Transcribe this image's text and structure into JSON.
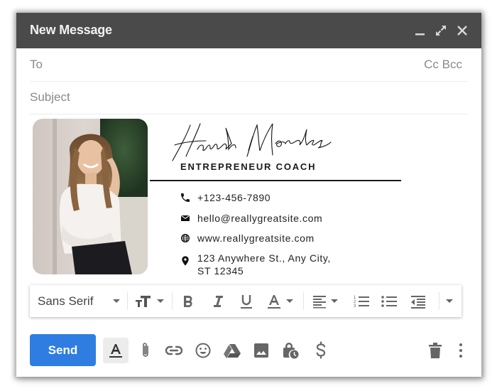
{
  "window": {
    "title": "New Message",
    "controls": {
      "minimize": "minimize",
      "expand": "expand",
      "close": "close"
    }
  },
  "fields": {
    "to_label": "To",
    "to_value": "",
    "cc_label": "Cc",
    "bcc_label": "Bcc",
    "subject_label": "Subject",
    "subject_value": ""
  },
  "signature": {
    "name": "Hannah Morales",
    "title": "ENTREPRENEUR COACH",
    "photo_alt": "Portrait photo of Hannah Morales",
    "contacts": [
      {
        "icon": "phone-icon",
        "text": "+123-456-7890"
      },
      {
        "icon": "email-icon",
        "text": "hello@reallygreatsite.com"
      },
      {
        "icon": "globe-icon",
        "text": "www.reallygreatsite.com"
      },
      {
        "icon": "location-pin-icon",
        "text_line1": "123 Anywhere St., Any City,",
        "text_line2": "ST 12345"
      }
    ]
  },
  "format_toolbar": {
    "font_family": "Sans Serif",
    "items": [
      "font-family",
      "font-size",
      "bold",
      "italic",
      "underline",
      "text-color",
      "align",
      "numbered-list",
      "bulleted-list",
      "indent-less",
      "more-formatting"
    ]
  },
  "bottom_bar": {
    "send_label": "Send",
    "items": [
      "formatting-options",
      "attach-files",
      "insert-link",
      "insert-emoji",
      "insert-drive",
      "insert-photo",
      "confidential-mode",
      "insert-money",
      "discard-draft",
      "more-options"
    ]
  },
  "colors": {
    "titlebar": "#4a4a4a",
    "send_button": "#2f7de1",
    "icon_gray": "#6b6b6b"
  }
}
